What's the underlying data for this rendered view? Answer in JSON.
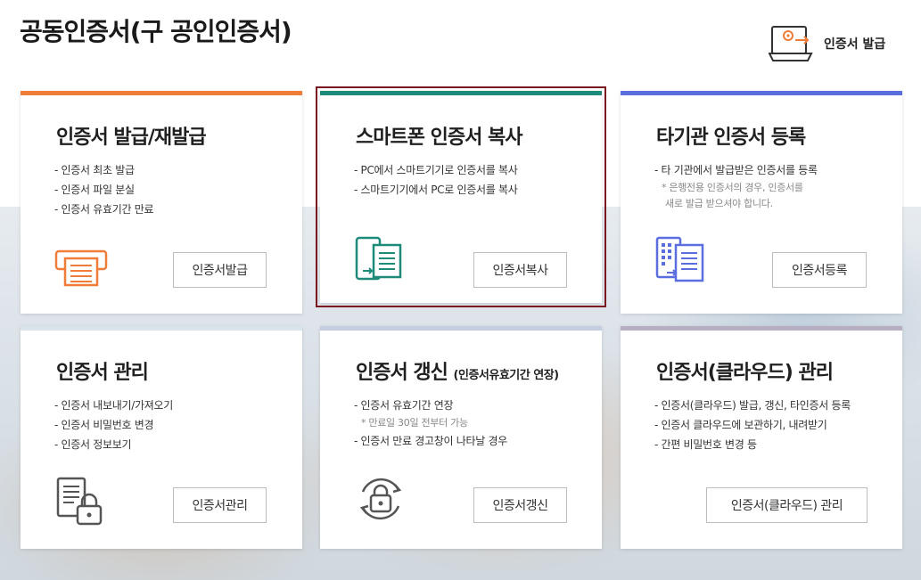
{
  "page_title": "공동인증서(구 공인인증서)",
  "issue_link": {
    "label": "인증서 발급",
    "icon": "laptop-gear-icon"
  },
  "cards": [
    {
      "title": "인증서 발급/재발급",
      "accent": "#f07c3a",
      "items": [
        "- 인증서 최초 발급",
        "- 인증서 파일 분실",
        "- 인증서 유효기간 만료"
      ],
      "button": "인증서발급",
      "icon": "printer-certificate-icon"
    },
    {
      "title": "스마트폰 인증서 복사",
      "accent": "#1e8a79",
      "items": [
        "- PC에서 스마트기기로 인증서를 복사",
        "- 스마트기기에서 PC로 인증서를 복사"
      ],
      "button": "인증서복사",
      "icon": "phone-copy-icon"
    },
    {
      "title": "타기관 인증서 등록",
      "accent": "#5a6ee0",
      "items": [
        "- 타 기관에서 발급받은 인증서를 등록"
      ],
      "notes": [
        "* 은행전용 인증서의 경우, 인증서를",
        "새로 발급 받으셔야 합니다."
      ],
      "button": "인증서등록",
      "icon": "document-register-icon"
    },
    {
      "title": "인증서 관리",
      "accent": "#d8e4ea",
      "items": [
        "- 인증서 내보내기/가져오기",
        "- 인증서 비밀번호 변경",
        "- 인증서 정보보기"
      ],
      "button": "인증서관리",
      "icon": "document-lock-icon"
    },
    {
      "title": "인증서 갱신",
      "title_sub": "(인증서유효기간 연장)",
      "accent": "#c5cde0",
      "items": [
        "- 인증서 유효기간 연장"
      ],
      "notes": [
        "* 만료일 30일 전부터 가능"
      ],
      "items2": [
        "- 인증서 만료 경고창이 나타날 경우"
      ],
      "button": "인증서갱신",
      "icon": "lock-refresh-icon"
    },
    {
      "title": "인증서(클라우드) 관리",
      "accent": "#b8aec2",
      "items": [
        "- 인증서(클라우드) 발급, 갱신, 타인증서 등록",
        "- 인증서 클라우드에 보관하기, 내려받기",
        "- 간편 비밀번호 변경 등"
      ],
      "button": "인증서(클라우드) 관리",
      "icon": "cloud-certificate-icon"
    }
  ]
}
